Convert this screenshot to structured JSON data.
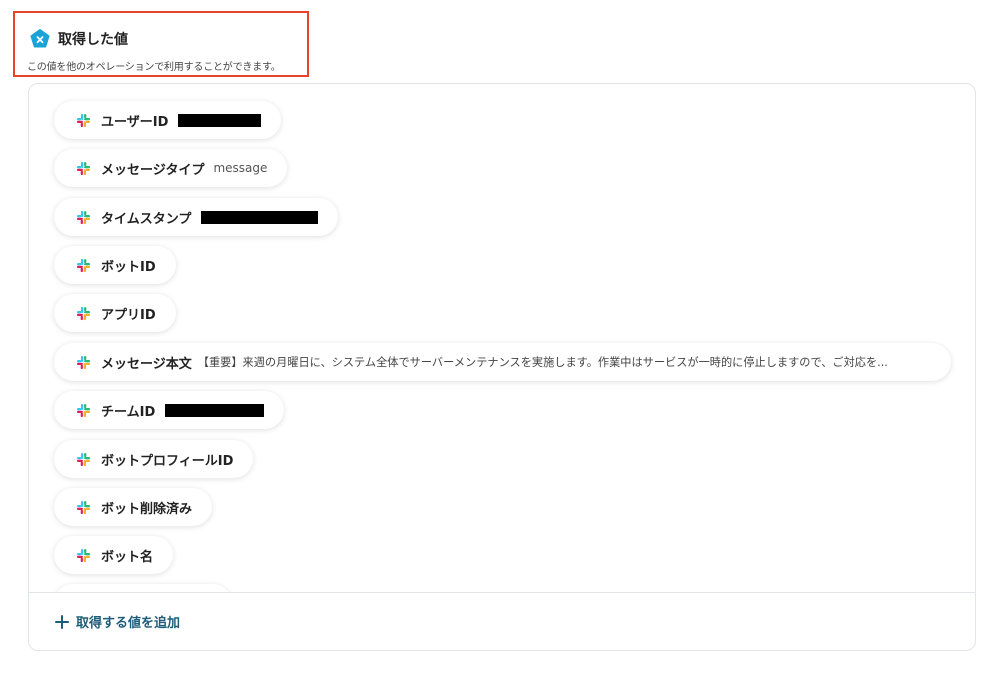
{
  "header": {
    "title": "取得した値",
    "description": "この値を他のオペレーションで利用することができます。",
    "badge_icon": "yoom-x-badge-icon",
    "badge_color": "#1aa3d6",
    "highlight_color": "#e8432b"
  },
  "fields": [
    {
      "label": "ユーザーID",
      "value": "",
      "redacted": true
    },
    {
      "label": "メッセージタイプ",
      "value": "message",
      "redacted": false
    },
    {
      "label": "タイムスタンプ",
      "value": "",
      "redacted": true
    },
    {
      "label": "ボットID",
      "value": "",
      "redacted": false
    },
    {
      "label": "アプリID",
      "value": "",
      "redacted": false
    },
    {
      "label": "メッセージ本文",
      "value": "【重要】来週の月曜日に、システム全体でサーバーメンテナンスを実施します。作業中はサービスが一時的に停止しますので、ご対応を...",
      "redacted": false
    },
    {
      "label": "チームID",
      "value": "",
      "redacted": true
    },
    {
      "label": "ボットプロフィールID",
      "value": "",
      "redacted": false
    },
    {
      "label": "ボット削除済み",
      "value": "",
      "redacted": false
    },
    {
      "label": "ボット名",
      "value": "",
      "redacted": false
    }
  ],
  "field_icon": "slack-icon",
  "add_button": {
    "label": "取得する値を追加",
    "icon": "plus-icon",
    "color": "#1f5d78"
  }
}
